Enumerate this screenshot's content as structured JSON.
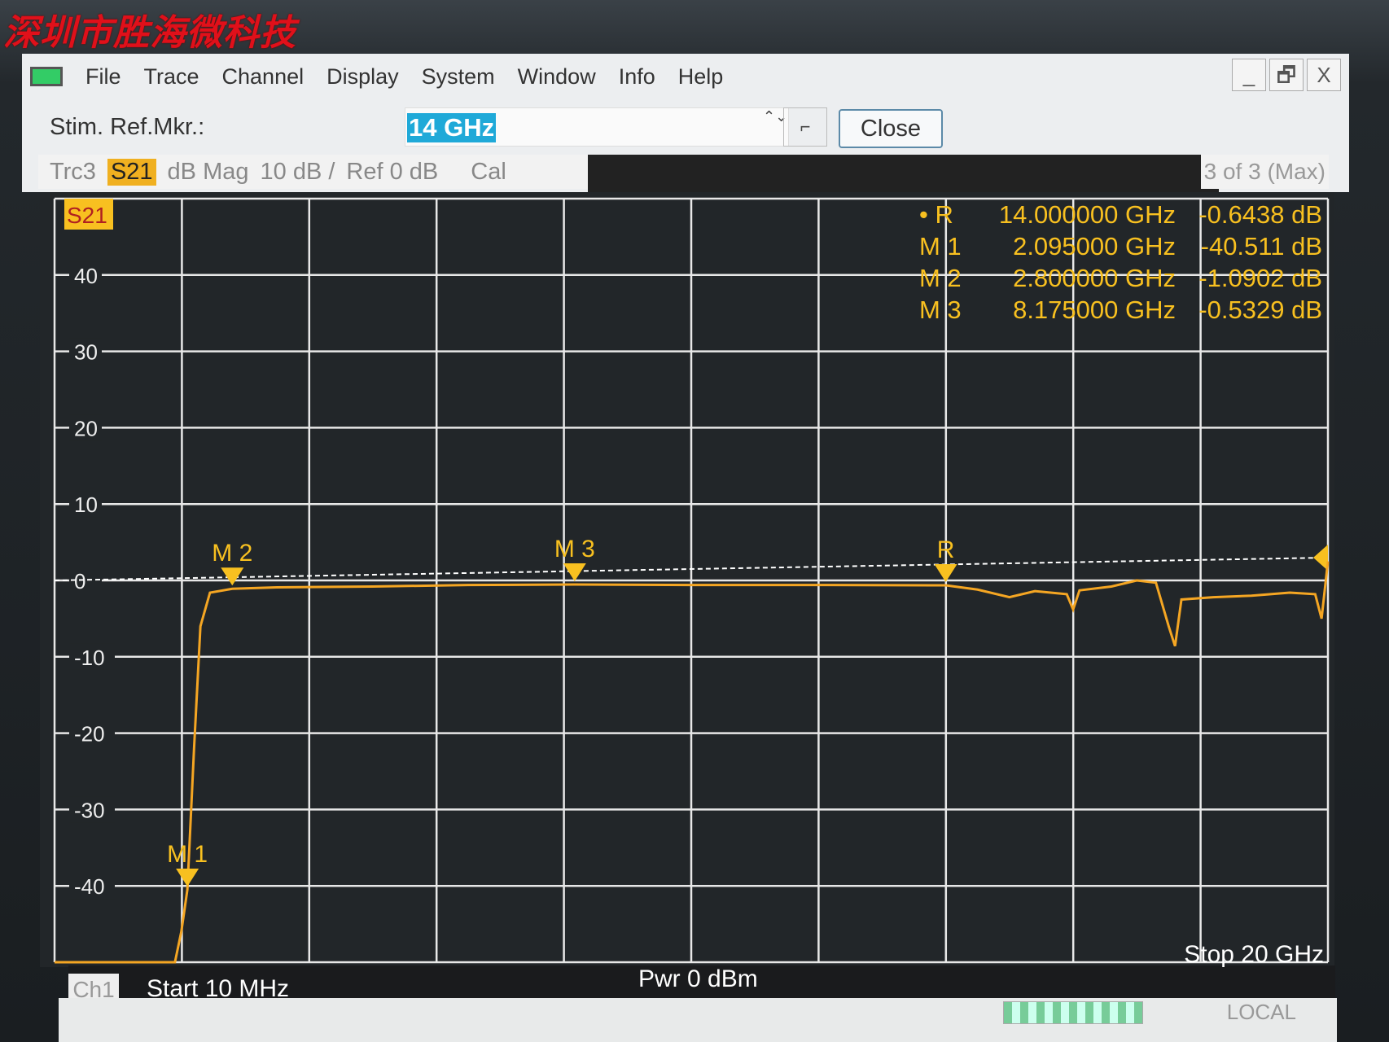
{
  "watermark": "深圳市胜海微科技",
  "menu": [
    "File",
    "Trace",
    "Channel",
    "Display",
    "System",
    "Window",
    "Info",
    "Help"
  ],
  "window_buttons": {
    "minimize": "_",
    "restore": "🗗",
    "close": "X"
  },
  "toolbar": {
    "label": "Stim. Ref.Mkr.:",
    "value": "14 GHz",
    "spin": "⌃⌄",
    "step": "⌐",
    "close": "Close"
  },
  "trace_bar": {
    "trace": "Trc3",
    "param": "S21",
    "format": "dB Mag",
    "scale": "10 dB /",
    "ref": "Ref 0 dB",
    "cal": "Cal",
    "count": "3 of 3 (Max)"
  },
  "footer": {
    "channel": "Ch1",
    "start": "Start  10 MHz",
    "power": "Pwr  0 dBm",
    "stop": "Stop  20 GHz",
    "local": "LOCAL"
  },
  "colors": {
    "trace": "#f5a623",
    "grid": "#e8e8e8",
    "background": "#222629",
    "marker": "#f8c020"
  },
  "chart_data": {
    "type": "line",
    "trace_label": "S21",
    "xlim": [
      0.01,
      20
    ],
    "x_unit": "GHz",
    "ylim": [
      -50,
      50
    ],
    "y_unit": "dB",
    "yticks": [
      40,
      30,
      20,
      10,
      0,
      -10,
      -20,
      -30,
      -40
    ],
    "grid": true,
    "reference_level": 0,
    "series": [
      {
        "x": [
          0.01,
          1.9,
          2.0,
          2.095,
          2.2,
          2.3,
          2.45,
          2.8,
          3.5,
          5,
          6.5,
          8.175,
          10,
          12,
          14,
          14.5,
          15,
          15.4,
          15.9,
          16.0,
          16.1,
          16.6,
          17.0,
          17.3,
          17.5,
          17.6,
          17.7,
          18.2,
          18.8,
          19.4,
          19.8,
          19.9,
          20
        ],
        "y": [
          -50,
          -50,
          -46,
          -40.5,
          -22,
          -6,
          -1.6,
          -1.09,
          -0.9,
          -0.8,
          -0.6,
          -0.53,
          -0.6,
          -0.6,
          -0.64,
          -1.2,
          -2.2,
          -1.4,
          -1.8,
          -3.8,
          -1.3,
          -0.8,
          0,
          -0.3,
          -6,
          -8.6,
          -2.5,
          -2.2,
          -2,
          -1.6,
          -1.8,
          -5,
          2.5
        ]
      }
    ],
    "markers": [
      {
        "name": "R",
        "label": "• R",
        "x": 14.0,
        "freq": "14.000000 GHz",
        "value": "-0.6438 dB",
        "y": -0.6438
      },
      {
        "name": "M 1",
        "label": "M 1",
        "x": 2.095,
        "freq": "2.095000 GHz",
        "value": "-40.511 dB",
        "y": -40.511
      },
      {
        "name": "M 2",
        "label": "M 2",
        "x": 2.8,
        "freq": "2.800000 GHz",
        "value": "-1.0902 dB",
        "y": -1.0902
      },
      {
        "name": "M 3",
        "label": "M 3",
        "x": 8.175,
        "freq": "8.175000 GHz",
        "value": "-0.5329 dB",
        "y": -0.5329
      }
    ]
  }
}
